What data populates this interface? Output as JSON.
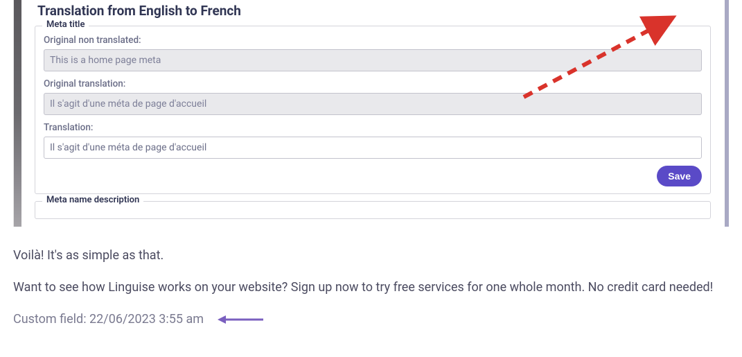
{
  "panel": {
    "title": "Translation from English to French",
    "meta_title_legend": "Meta title",
    "original_non_translated_label": "Original non translated:",
    "original_non_translated_value": "This is a home page meta",
    "original_translation_label": "Original translation:",
    "original_translation_value": "Il s'agit d'une méta de page d'accueil",
    "translation_label": "Translation:",
    "translation_value": "Il s'agit d'une méta de page d'accueil",
    "save_label": "Save",
    "meta_name_description_legend": "Meta name description"
  },
  "article": {
    "line1": "Voilà! It's as simple as that.",
    "line2": "Want to see how Linguise works on your website? Sign up now to try free services for one whole month. No credit card needed!",
    "custom_field_label": "Custom field:",
    "custom_field_value": "22/06/2023 3:55 am"
  }
}
